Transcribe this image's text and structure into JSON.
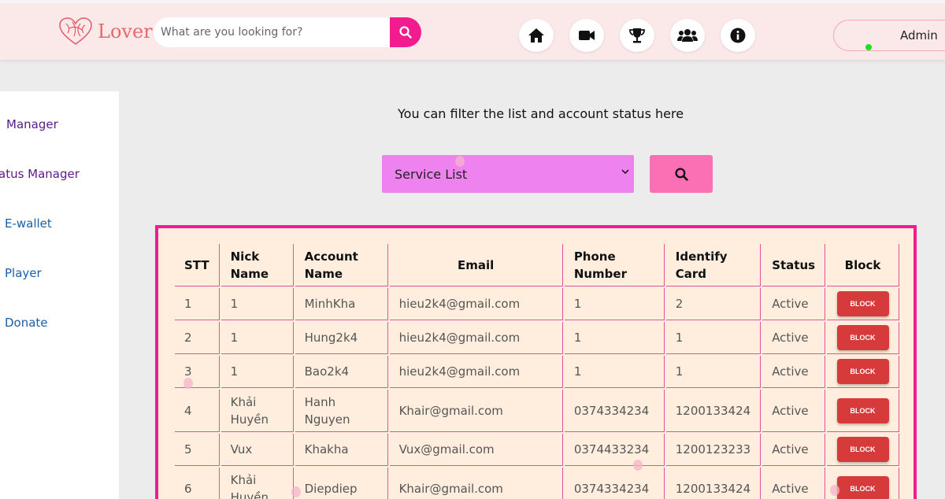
{
  "header": {
    "logo_text": "Lover",
    "search_placeholder": "What are you looking for?",
    "nav_icons": [
      "home-icon",
      "video-icon",
      "trophy-icon",
      "users-icon",
      "info-icon"
    ],
    "user_name": "Admin"
  },
  "sidebar": {
    "items": [
      {
        "label": "Manager"
      },
      {
        "label": "atus Manager"
      },
      {
        "label": "E-wallet"
      },
      {
        "label": "Player"
      },
      {
        "label": "Donate"
      }
    ]
  },
  "main": {
    "filter_text": "You can filter the list and account status here",
    "select_value": "Service List",
    "table": {
      "headers": [
        "STT",
        "Nick Name",
        "Account Name",
        "Email",
        "Phone Number",
        "Identify Card",
        "Status",
        "Block"
      ],
      "rows": [
        {
          "stt": "1",
          "nick": "1",
          "account": "MinhKha",
          "email": "hieu2k4@gmail.com",
          "phone": "1",
          "card": "2",
          "status": "Active",
          "block": "BLOCK"
        },
        {
          "stt": "2",
          "nick": "1",
          "account": "Hung2k4",
          "email": "hieu2k4@gmail.com",
          "phone": "1",
          "card": "1",
          "status": "Active",
          "block": "BLOCK"
        },
        {
          "stt": "3",
          "nick": "1",
          "account": "Bao2k4",
          "email": "hieu2k4@gmail.com",
          "phone": "1",
          "card": "1",
          "status": "Active",
          "block": "BLOCK"
        },
        {
          "stt": "4",
          "nick": "Khải Huyền",
          "account": "Hanh Nguyen",
          "email": "Khair@gmail.com",
          "phone": "0374334234",
          "card": "1200133424",
          "status": "Active",
          "block": "BLOCK"
        },
        {
          "stt": "5",
          "nick": "Vux",
          "account": "Khakha",
          "email": "Vux@gmail.com",
          "phone": "0374433234",
          "card": "1200123233",
          "status": "Active",
          "block": "BLOCK"
        },
        {
          "stt": "6",
          "nick": "Khải Huyền",
          "account": "Diepdiep",
          "email": "Khair@gmail.com",
          "phone": "0374334234",
          "card": "1200133424",
          "status": "Active",
          "block": "BLOCK"
        }
      ]
    }
  },
  "colors": {
    "accent": "#f21c8e",
    "select_bg": "#ee82ee",
    "table_bg": "#ffeedd",
    "block_button": "#d63a3a",
    "header_bg": "#fbe9ea"
  }
}
